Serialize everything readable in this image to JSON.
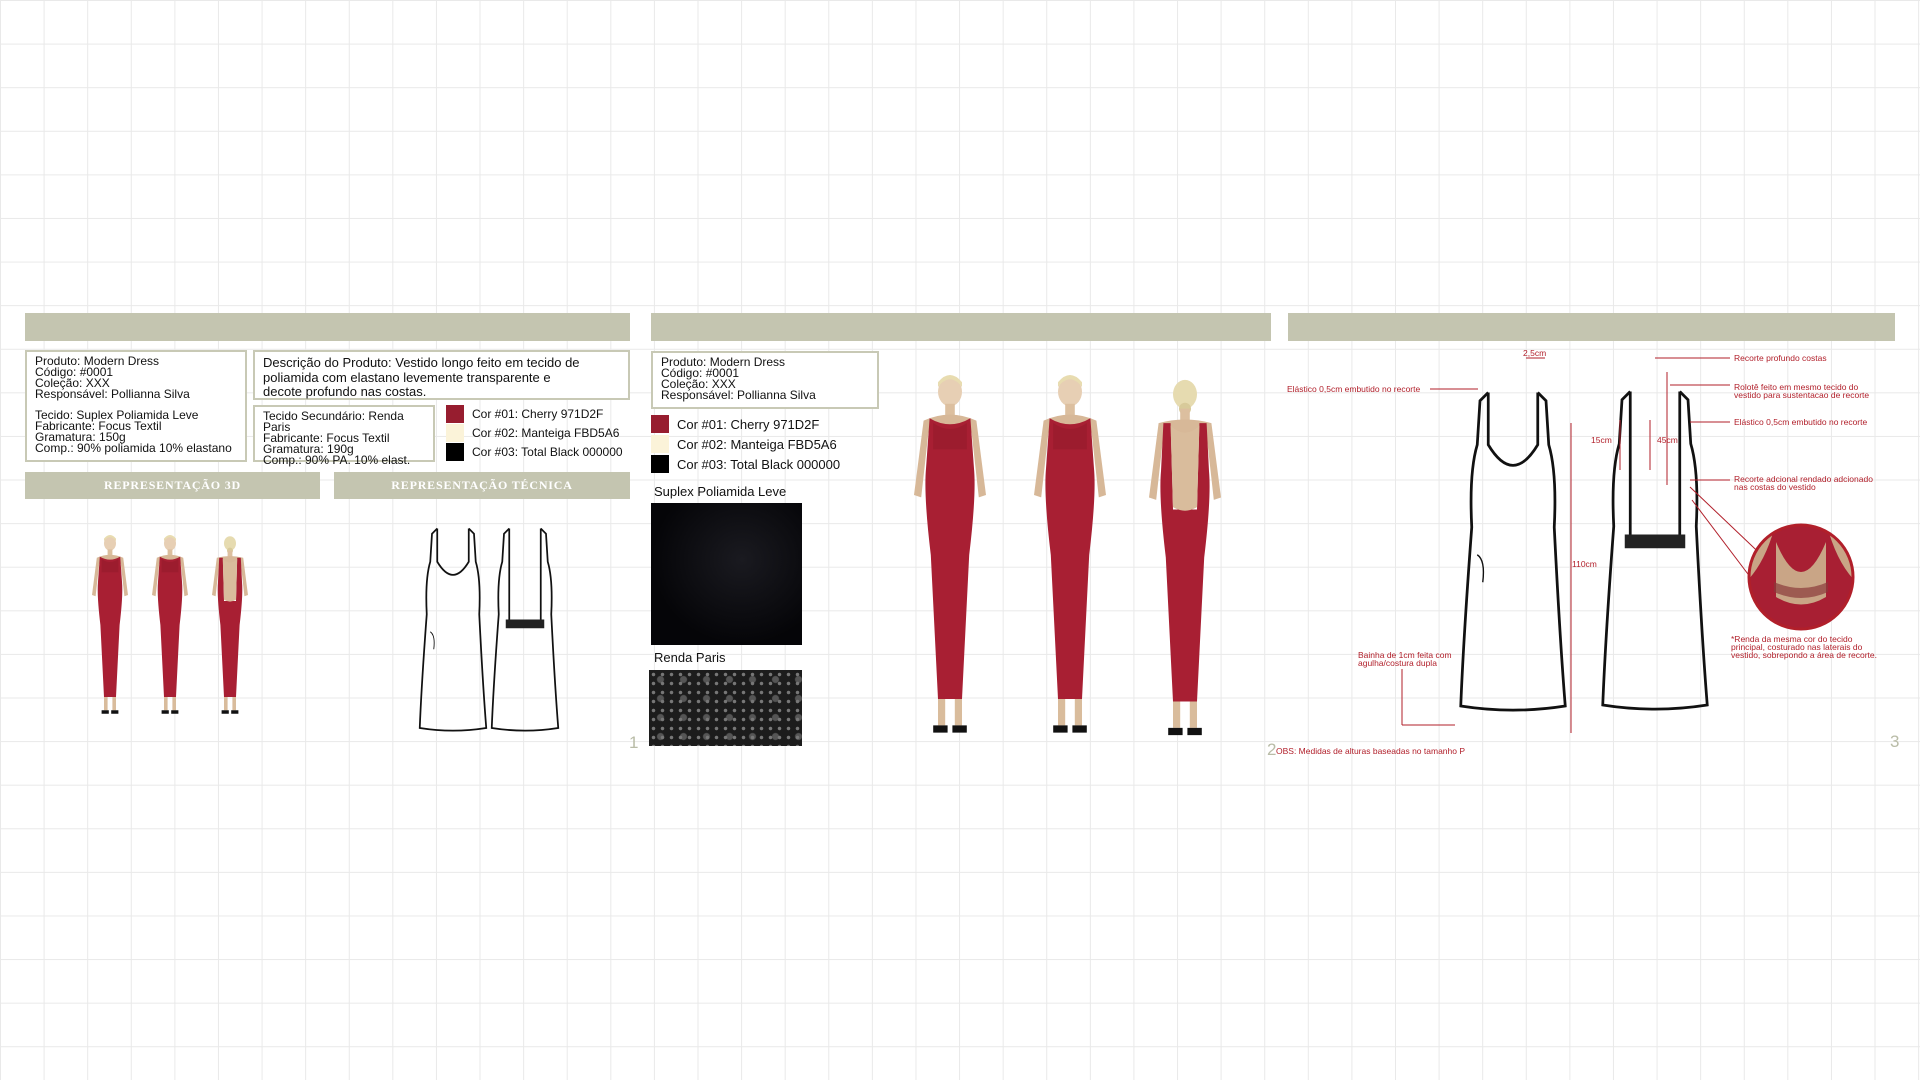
{
  "product": {
    "name_line": "Produto: Modern Dress",
    "code_line": "Código: #0001",
    "collection_line": "Coleção: XXX",
    "responsible_line": "Responsável: Pollianna Silva"
  },
  "fabric_primary": {
    "name_line": "Tecido: Suplex Poliamida Leve",
    "maker_line": "Fabricante: Focus Textil",
    "weight_line": "Gramatura: 150g",
    "comp_line": "Comp.: 90% poliamida 10% elastano"
  },
  "fabric_secondary": {
    "name_line": "Tecido Secundário: Renda Paris",
    "maker_line": "Fabricante: Focus Textil",
    "weight_line": "Gramatura: 190g",
    "comp_line": "Comp.: 90% PA. 10% elast."
  },
  "description": {
    "line1": "Descrição do Produto: Vestido longo feito em tecido de",
    "line2": "poliamida com elastano levemente transparente e",
    "line3": "decote profundo nas costas."
  },
  "colors": [
    {
      "label": "Cor #01: Cherry 971D2F",
      "hex": "#971D2F"
    },
    {
      "label": "Cor #02: Manteiga FBD5A6",
      "hex": "#FBF3D9"
    },
    {
      "label": "Cor #03: Total Black 000000",
      "hex": "#000000"
    }
  ],
  "sections": {
    "rep3d": "REPRESENTAÇÃO 3D",
    "reptec": "REPRESENTAÇÃO TÉCNICA"
  },
  "fabric_labels": {
    "suplex": "Suplex Poliamida Leve",
    "renda": "Renda Paris"
  },
  "page_numbers": [
    "1",
    "2",
    "3"
  ],
  "tech_notes": {
    "measure_top": "2,5cm",
    "elastic_left": "Elástico 0,5cm embutido no recorte",
    "measure_15": "15cm",
    "measure_45": "45cm",
    "measure_110": "110cm",
    "hem_line1": "Bainha de 1cm feita com",
    "hem_line2": "agulha/costura dupla",
    "obs": "OBS: Medidas de alturas baseadas no tamanho P",
    "cut_back": "Recorte profundo costas",
    "rolote_line1": "Rolotê feito em mesmo tecido do",
    "rolote_line2": "vestido para sustentacao de recorte",
    "elastic_right": "Elástico 0,5cm embutido no recorte",
    "lace_cut_line1": "Recorte adcional rendado adcionado",
    "lace_cut_line2": "nas costas do vestido",
    "lace_note_line1": "*Renda da mesma cor do tecido",
    "lace_note_line2": "principal, costurado nas laterais do",
    "lace_note_line3": "vestido, sobrepondo a área de recorte."
  }
}
